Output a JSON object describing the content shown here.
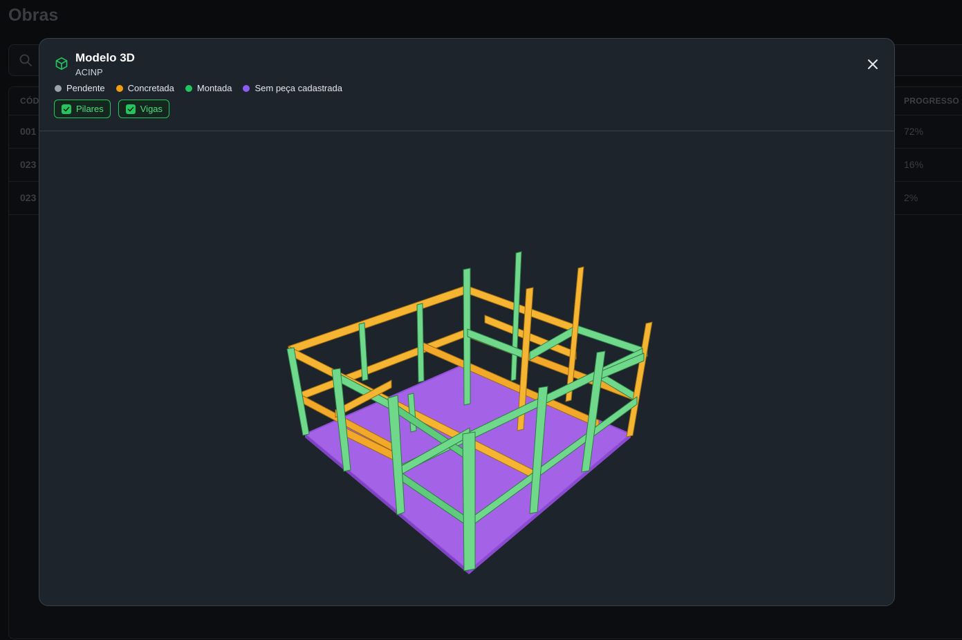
{
  "background": {
    "page_title": "Obras",
    "columns": {
      "code": "CÓD",
      "progress": "PROGRESSO"
    },
    "rows": [
      {
        "code": "001",
        "progress": "72%"
      },
      {
        "code": "023",
        "progress": "16%"
      },
      {
        "code": "023",
        "progress": "2%"
      }
    ]
  },
  "modal": {
    "title": "Modelo 3D",
    "subtitle": "ACINP",
    "close_icon": "close-icon",
    "header_icon": "cube-icon",
    "legend": [
      {
        "label": "Pendente",
        "color": "#9ca3af"
      },
      {
        "label": "Concretada",
        "color": "#f59e0b"
      },
      {
        "label": "Montada",
        "color": "#22c55e"
      },
      {
        "label": "Sem peça cadastrada",
        "color": "#8b5cf6"
      }
    ],
    "filters": [
      {
        "label": "Pilares",
        "checked": true
      },
      {
        "label": "Vigas",
        "checked": true
      }
    ]
  },
  "colors": {
    "accent": "#22c55e",
    "concretada": "#f5b533",
    "montada": "#6fd88b",
    "sem_peca": "#a463e6"
  }
}
